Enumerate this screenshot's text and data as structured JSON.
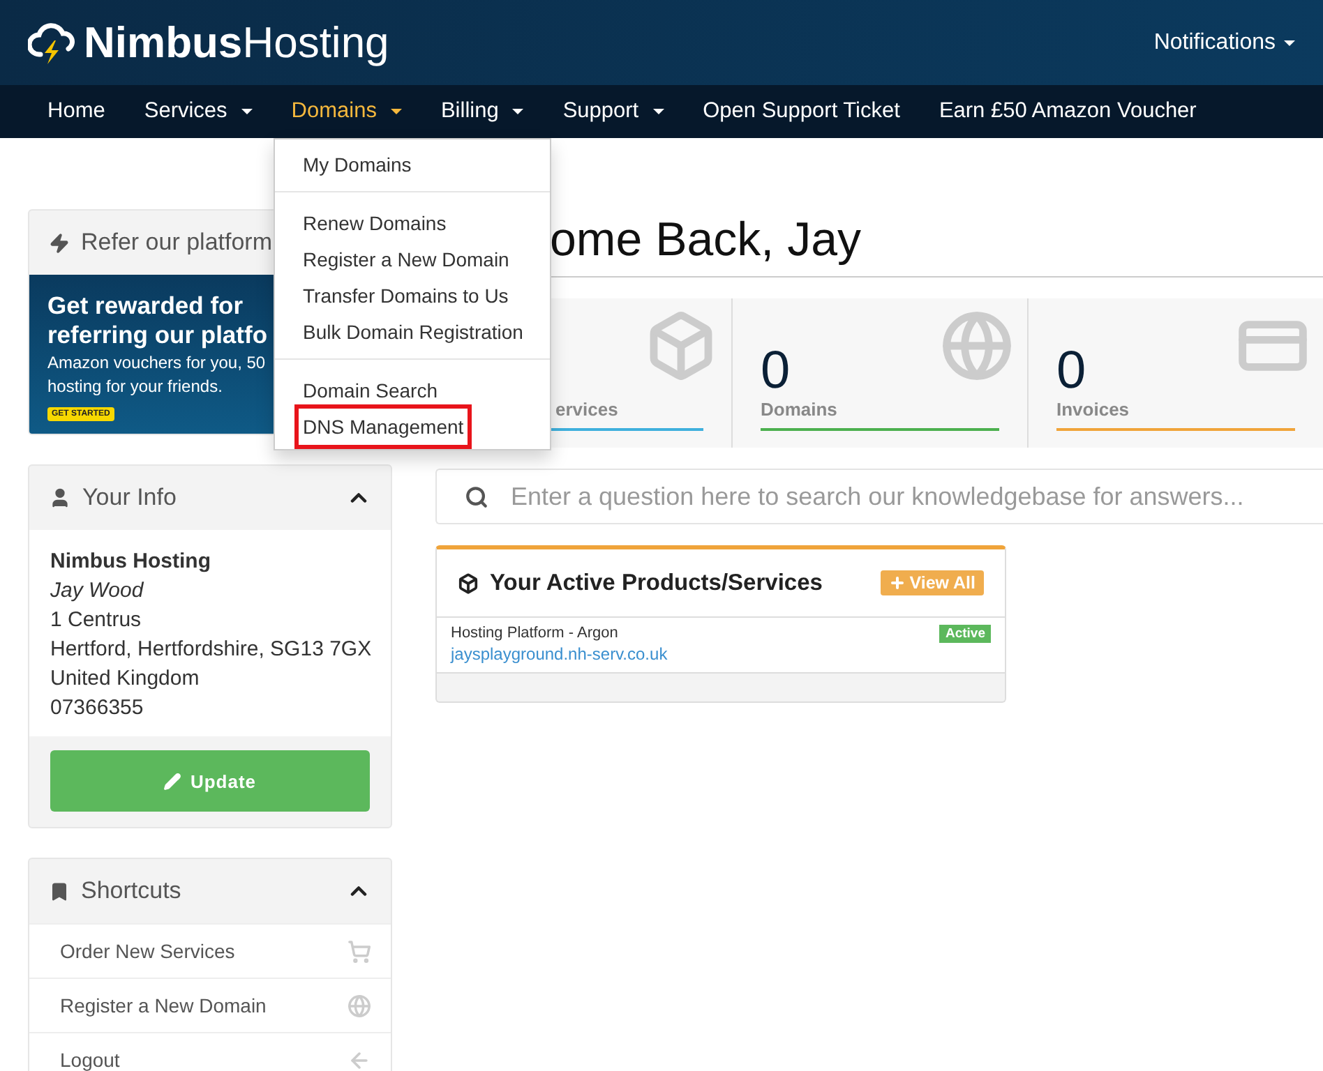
{
  "header": {
    "logo_bold": "Nimbus",
    "logo_light": "Hosting",
    "notifications": "Notifications"
  },
  "nav": [
    {
      "label": "Home",
      "dropdown": false,
      "selected": false
    },
    {
      "label": "Services",
      "dropdown": true,
      "selected": false
    },
    {
      "label": "Domains",
      "dropdown": true,
      "selected": true
    },
    {
      "label": "Billing",
      "dropdown": true,
      "selected": false
    },
    {
      "label": "Support",
      "dropdown": true,
      "selected": false
    },
    {
      "label": "Open Support Ticket",
      "dropdown": false,
      "selected": false
    },
    {
      "label": "Earn £50 Amazon Voucher",
      "dropdown": false,
      "selected": false
    }
  ],
  "domains_menu": {
    "groups": [
      [
        {
          "label": "My Domains",
          "highlighted": false
        }
      ],
      [
        {
          "label": "Renew Domains",
          "highlighted": false
        },
        {
          "label": "Register a New Domain",
          "highlighted": false
        },
        {
          "label": "Transfer Domains to Us",
          "highlighted": false
        },
        {
          "label": "Bulk Domain Registration",
          "highlighted": false
        }
      ],
      [
        {
          "label": "Domain Search",
          "highlighted": false
        },
        {
          "label": "DNS Management",
          "highlighted": true
        }
      ]
    ]
  },
  "refer_panel": {
    "title": "Refer our platform",
    "headline": [
      "Get rewarded for",
      "referring our platfo"
    ],
    "body": [
      "Amazon vouchers for you, 50",
      "hosting for your friends."
    ],
    "cta": "GET STARTED"
  },
  "your_info": {
    "title": "Your Info",
    "expanded": true,
    "lines": [
      {
        "text": "Nimbus Hosting",
        "kind": "bold"
      },
      {
        "text": "Jay Wood",
        "kind": "italic"
      },
      {
        "text": "1 Centrus",
        "kind": "plain"
      },
      {
        "text": "Hertford, Hertfordshire, SG13 7GX",
        "kind": "plain"
      },
      {
        "text": "United Kingdom",
        "kind": "plain"
      },
      {
        "text": "07366355",
        "kind": "plain"
      }
    ],
    "button": "Update"
  },
  "shortcuts": {
    "title": "Shortcuts",
    "expanded": true,
    "items": [
      {
        "label": "Order New Services",
        "kind": "cart"
      },
      {
        "label": "Register a New Domain",
        "kind": "globe"
      },
      {
        "label": "Logout",
        "kind": "back"
      }
    ]
  },
  "title": "ome Back, Jay",
  "stats": [
    {
      "label": "ervices",
      "kind": "box",
      "color": "#3fb0dd"
    },
    {
      "value": "0",
      "label": "Domains",
      "kind": "globe",
      "color": "#4cb04f"
    },
    {
      "value": "0",
      "label": "Invoices",
      "kind": "card",
      "color": "#f0a43a"
    }
  ],
  "search": {
    "placeholder": "Enter a question here to search our knowledgebase for answers..."
  },
  "products": {
    "title": "Your Active Products/Services",
    "view_all": "View All",
    "items": [
      {
        "name": "Hosting Platform - Argon",
        "domain": "jaysplayground.nh-serv.co.uk",
        "status": "Active"
      }
    ]
  }
}
